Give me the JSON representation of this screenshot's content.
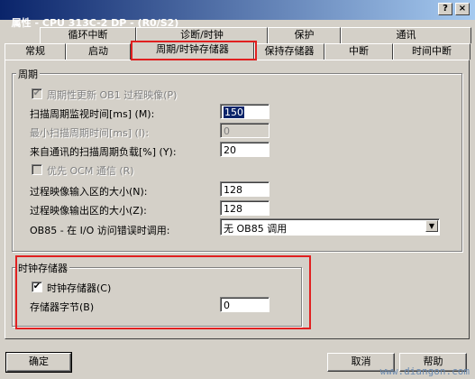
{
  "window": {
    "title": "属性 - CPU 313C-2 DP - (R0/S2)",
    "close_glyph": "×",
    "help_glyph": "?"
  },
  "tabs_row1": [
    {
      "label": "循环中断"
    },
    {
      "label": "诊断/时钟"
    },
    {
      "label": "保护"
    },
    {
      "label": "通讯"
    }
  ],
  "tabs_row2": [
    {
      "label": "常规"
    },
    {
      "label": "启动"
    },
    {
      "label": "周期/时钟存储器"
    },
    {
      "label": "保持存储器"
    },
    {
      "label": "中断"
    },
    {
      "label": "时间中断"
    }
  ],
  "cycle_group": {
    "title": "周期",
    "update_image": {
      "label": "周期性更新 OB1 过程映像(P)",
      "checked": true,
      "enabled": false
    },
    "scan_monitor": {
      "label": "扫描周期监视时间[ms] (M):",
      "value": "150"
    },
    "min_scan": {
      "label": "最小扫描周期时间[ms] (I):",
      "value": "0"
    },
    "comm_load": {
      "label": "来自通讯的扫描周期负载[%] (Y):",
      "value": "20"
    },
    "ocm_priority": {
      "label": "优先 OCM 通信 (R)",
      "checked": false,
      "enabled": false
    },
    "input_image_size": {
      "label": "过程映像输入区的大小(N):",
      "value": "128"
    },
    "output_image_size": {
      "label": "过程映像输出区的大小(Z):",
      "value": "128"
    },
    "ob85": {
      "label": "OB85 - 在 I/O 访问错误时调用:",
      "value": "无 OB85 调用",
      "arrow": "▼"
    }
  },
  "clock_group": {
    "title": "时钟存储器",
    "clock_memory": {
      "label": "时钟存储器(C)",
      "checked": true,
      "check_glyph": "✔"
    },
    "memory_byte": {
      "label": "存储器字节(B)",
      "value": "0"
    }
  },
  "buttons": {
    "ok": "确定",
    "cancel": "取消",
    "help": "帮助"
  },
  "watermark": "www.diangon.com"
}
